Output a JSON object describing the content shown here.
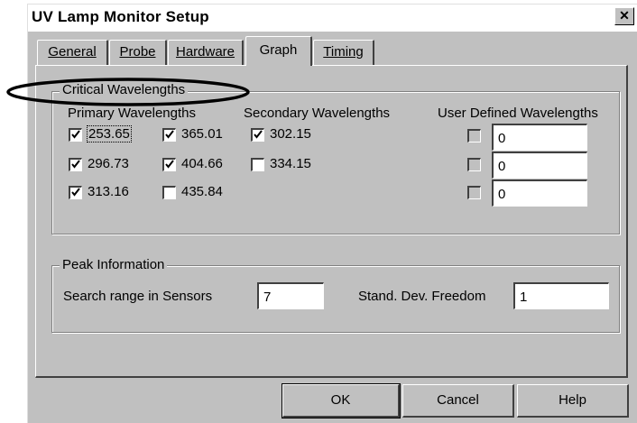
{
  "window": {
    "title": "UV Lamp Monitor Setup",
    "close_glyph": "✕"
  },
  "tabs": [
    {
      "label": "General",
      "active": false
    },
    {
      "label": "Probe",
      "active": false
    },
    {
      "label": "Hardware",
      "active": false
    },
    {
      "label": "Graph",
      "active": true
    },
    {
      "label": "Timing",
      "active": false
    }
  ],
  "critical": {
    "legend": "Critical Wavelengths",
    "primary_header": "Primary Wavelengths",
    "secondary_header": "Secondary Wavelengths",
    "user_header": "User Defined Wavelengths",
    "primary": [
      {
        "label": "253.65",
        "checked": true
      },
      {
        "label": "365.01",
        "checked": true
      },
      {
        "label": "296.73",
        "checked": true
      },
      {
        "label": "404.66",
        "checked": true
      },
      {
        "label": "313.16",
        "checked": true
      },
      {
        "label": "435.84",
        "checked": false
      }
    ],
    "secondary": [
      {
        "label": "302.15",
        "checked": true
      },
      {
        "label": "334.15",
        "checked": false
      }
    ],
    "user": [
      {
        "value": "0",
        "checked": false
      },
      {
        "value": "0",
        "checked": false
      },
      {
        "value": "0",
        "checked": false
      }
    ]
  },
  "peak": {
    "legend": "Peak Information",
    "search_label": "Search range in Sensors",
    "search_value": "7",
    "stddev_label": "Stand. Dev. Freedom",
    "stddev_value": "1"
  },
  "buttons": {
    "ok": "OK",
    "cancel": "Cancel",
    "help": "Help"
  },
  "annotation": {
    "shape": "ellipse",
    "color": "#000000"
  }
}
